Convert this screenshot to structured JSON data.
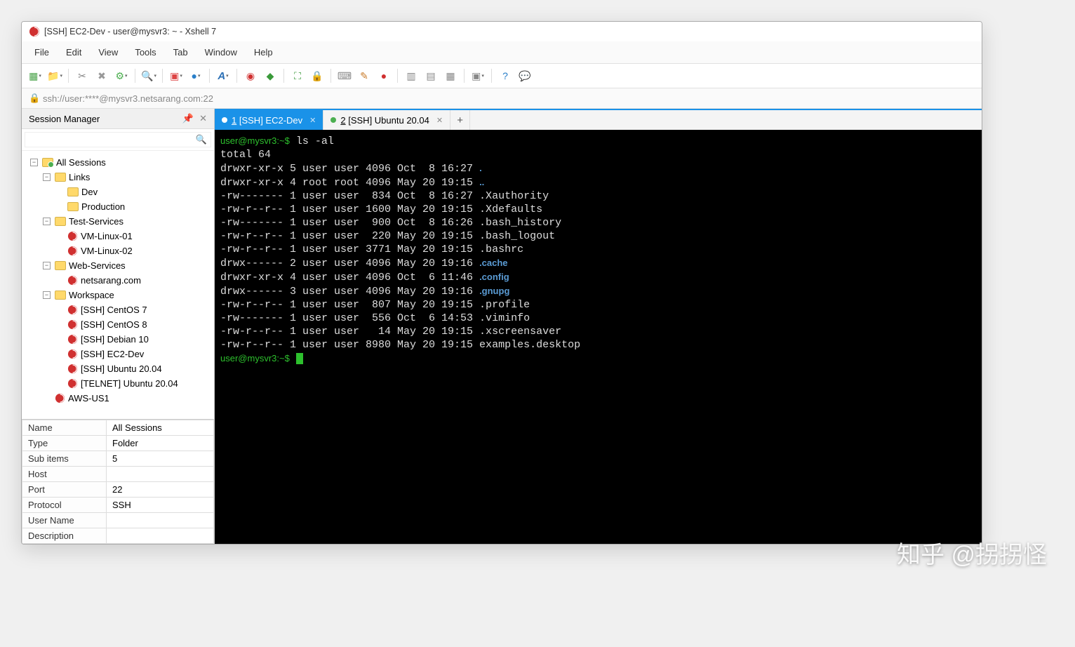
{
  "window": {
    "title": "[SSH] EC2-Dev - user@mysvr3: ~ - Xshell 7"
  },
  "menubar": [
    "File",
    "Edit",
    "View",
    "Tools",
    "Tab",
    "Window",
    "Help"
  ],
  "toolbar_icons": [
    {
      "name": "new-session-icon",
      "glyph": "▦",
      "color": "#49a249",
      "dd": true
    },
    {
      "name": "open-folder-icon",
      "glyph": "📁",
      "color": "#d8a23a",
      "dd": true
    },
    "sep",
    {
      "name": "link-icon",
      "glyph": "✂",
      "color": "#888"
    },
    {
      "name": "disconnect-icon",
      "glyph": "✖",
      "color": "#999"
    },
    {
      "name": "gear-icon",
      "glyph": "⚙",
      "color": "#4caf50",
      "dd": true
    },
    "sep",
    {
      "name": "search-icon",
      "glyph": "🔍",
      "color": "#888",
      "dd": true
    },
    "sep",
    {
      "name": "server-icon",
      "glyph": "▣",
      "color": "#d44",
      "dd": true
    },
    {
      "name": "globe-icon",
      "glyph": "●",
      "color": "#2a7fc9",
      "dd": true
    },
    "sep",
    {
      "name": "font-icon",
      "glyph": "A",
      "color": "#2a6fb5",
      "style": "italic",
      "dd": true
    },
    "sep",
    {
      "name": "app-icon",
      "glyph": "◉",
      "color": "#d03030"
    },
    {
      "name": "xftp-icon",
      "glyph": "◆",
      "color": "#3a9a3a"
    },
    "sep",
    {
      "name": "fullscreen-icon",
      "glyph": "⛶",
      "color": "#3a9a3a"
    },
    {
      "name": "lock-icon",
      "glyph": "🔒",
      "color": "#c89b3a"
    },
    "sep",
    {
      "name": "keyboard-icon",
      "glyph": "⌨",
      "color": "#888"
    },
    {
      "name": "highlighter-icon",
      "glyph": "✎",
      "color": "#c97b2a"
    },
    {
      "name": "record-icon",
      "glyph": "●",
      "color": "#d03030"
    },
    "sep",
    {
      "name": "tile-h-icon",
      "glyph": "▥",
      "color": "#888"
    },
    {
      "name": "tile-v-icon",
      "glyph": "▤",
      "color": "#888"
    },
    {
      "name": "cascade-icon",
      "glyph": "▦",
      "color": "#888"
    },
    "sep",
    {
      "name": "arrange-icon",
      "glyph": "▣",
      "color": "#888",
      "dd": true
    },
    "sep",
    {
      "name": "help-icon",
      "glyph": "?",
      "color": "#2a7fc9"
    },
    {
      "name": "feedback-icon",
      "glyph": "💬",
      "color": "#3a9a8a"
    }
  ],
  "address": "ssh://user:****@mysvr3.netsarang.com:22",
  "session_panel": {
    "title": "Session Manager",
    "root_label": "All Sessions",
    "search_placeholder": "",
    "tree": [
      {
        "type": "folder",
        "label": "Links",
        "children": [
          {
            "type": "folder",
            "label": "Dev"
          },
          {
            "type": "folder",
            "label": "Production"
          }
        ]
      },
      {
        "type": "folder",
        "label": "Test-Services",
        "children": [
          {
            "type": "session",
            "label": "VM-Linux-01"
          },
          {
            "type": "session",
            "label": "VM-Linux-02"
          }
        ]
      },
      {
        "type": "folder",
        "label": "Web-Services",
        "children": [
          {
            "type": "session",
            "label": "netsarang.com"
          }
        ]
      },
      {
        "type": "folder",
        "label": "Workspace",
        "children": [
          {
            "type": "session",
            "label": "[SSH] CentOS 7"
          },
          {
            "type": "session",
            "label": "[SSH] CentOS 8"
          },
          {
            "type": "session",
            "label": "[SSH] Debian 10"
          },
          {
            "type": "session",
            "label": "[SSH] EC2-Dev"
          },
          {
            "type": "session",
            "label": "[SSH] Ubuntu 20.04"
          },
          {
            "type": "session",
            "label": "[TELNET] Ubuntu 20.04"
          }
        ]
      },
      {
        "type": "session",
        "label": "AWS-US1"
      }
    ],
    "props": [
      [
        "Name",
        "All Sessions"
      ],
      [
        "Type",
        "Folder"
      ],
      [
        "Sub items",
        "5"
      ],
      [
        "Host",
        ""
      ],
      [
        "Port",
        "22"
      ],
      [
        "Protocol",
        "SSH"
      ],
      [
        "User Name",
        ""
      ],
      [
        "Description",
        ""
      ]
    ]
  },
  "tabs": [
    {
      "label": "1 [SSH] EC2-Dev",
      "status": "connected",
      "active": true,
      "underline": "1"
    },
    {
      "label": "2 [SSH] Ubuntu 20.04",
      "status": "connected",
      "active": false,
      "underline": "2"
    }
  ],
  "terminal": {
    "prompt": "user@mysvr3:~$",
    "command": "ls -al",
    "lines": [
      {
        "text": "total 64"
      },
      {
        "perm": "drwxr-xr-x 5 user user 4096 Oct  8 16:27 ",
        "name": ".",
        "blue": true
      },
      {
        "perm": "drwxr-xr-x 4 root root 4096 May 20 19:15 ",
        "name": "..",
        "blue": true
      },
      {
        "perm": "-rw------- 1 user user  834 Oct  8 16:27 ",
        "name": ".Xauthority"
      },
      {
        "perm": "-rw-r--r-- 1 user user 1600 May 20 19:15 ",
        "name": ".Xdefaults"
      },
      {
        "perm": "-rw------- 1 user user  900 Oct  8 16:26 ",
        "name": ".bash_history"
      },
      {
        "perm": "-rw-r--r-- 1 user user  220 May 20 19:15 ",
        "name": ".bash_logout"
      },
      {
        "perm": "-rw-r--r-- 1 user user 3771 May 20 19:15 ",
        "name": ".bashrc"
      },
      {
        "perm": "drwx------ 2 user user 4096 May 20 19:16 ",
        "name": ".cache",
        "blue": true
      },
      {
        "perm": "drwxr-xr-x 4 user user 4096 Oct  6 11:46 ",
        "name": ".config",
        "blue": true
      },
      {
        "perm": "drwx------ 3 user user 4096 May 20 19:16 ",
        "name": ".gnupg",
        "blue": true
      },
      {
        "perm": "-rw-r--r-- 1 user user  807 May 20 19:15 ",
        "name": ".profile"
      },
      {
        "perm": "-rw------- 1 user user  556 Oct  6 14:53 ",
        "name": ".viminfo"
      },
      {
        "perm": "-rw-r--r-- 1 user user   14 May 20 19:15 ",
        "name": ".xscreensaver"
      },
      {
        "perm": "-rw-r--r-- 1 user user 8980 May 20 19:15 ",
        "name": "examples.desktop"
      }
    ]
  },
  "watermark": "知乎 @拐拐怪"
}
